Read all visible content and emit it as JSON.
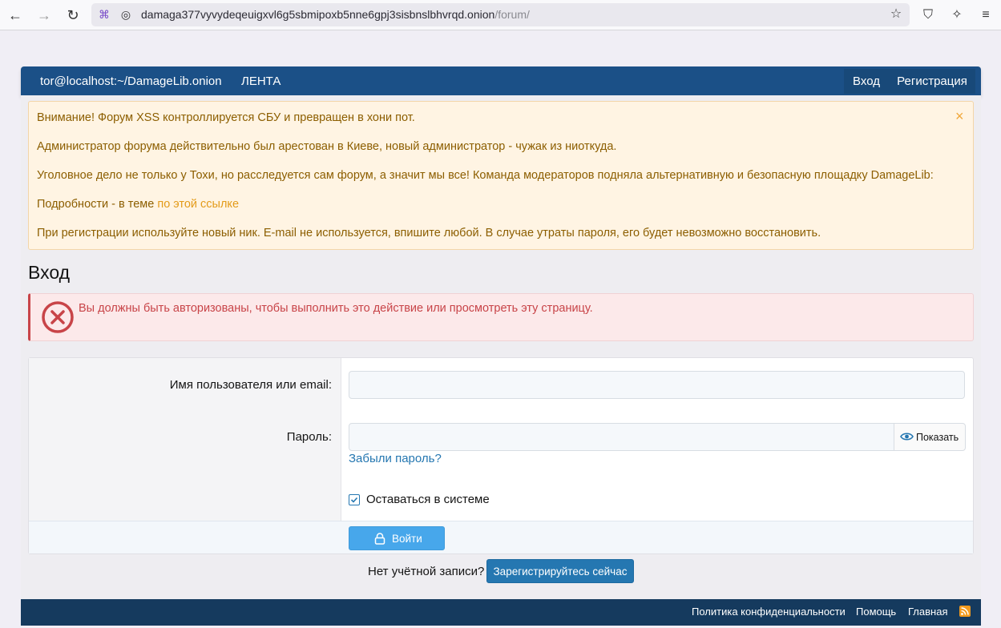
{
  "browser": {
    "url_host": "damaga377vyvydeqeuigxvl6g5sbmipoxb5nne6gpj3sisbnslbhvrqd.onion",
    "url_path": "/forum/"
  },
  "nav": {
    "brand": "tor@localhost:~/DamageLib.onion",
    "lenta": "ЛЕНТА",
    "login": "Вход",
    "register": "Регистрация"
  },
  "notice": {
    "line1": "Внимание! Форум XSS контроллируется СБУ и превращен в хони пот.",
    "line2": "Администратор форума действительно был арестован в Киеве, новый администратор - чужак из ниоткуда.",
    "line3": "Уголовное дело не только у Тохи, но расследуется сам форум, а значит мы все! Команда модераторов подняла альтернативную и безопасную площадку DamageLib:",
    "line4_prefix": "Подробности - в теме",
    "line4_link": "по этой ссылке",
    "line5": "При регистрации используйте новый ник. E-mail не используется, впишите любой. В случае утраты пароля, его будет невозможно восстановить.",
    "close": "×"
  },
  "page": {
    "title": "Вход",
    "error_text": "Вы должны быть авторизованы, чтобы выполнить это действие или просмотреть эту страницу."
  },
  "form": {
    "username_label": "Имя пользователя или email:",
    "password_label": "Пароль:",
    "show_password": "Показать",
    "forgot": "Забыли пароль?",
    "remember": "Оставаться в системе",
    "remember_checked": true,
    "submit": "Войти"
  },
  "signup": {
    "prompt": "Нет учётной записи?",
    "button": "Зарегистрируйтесь сейчас"
  },
  "footer": {
    "privacy": "Политика конфиденциальности",
    "help": "Помощь",
    "home": "Главная"
  },
  "colors": {
    "nav_bg": "#1b5087",
    "footer_bg": "#153a5e",
    "notice_bg": "#fff4e3",
    "error_accent": "#c84448",
    "link": "#2577b1",
    "submit_bg": "#47a7eb"
  }
}
